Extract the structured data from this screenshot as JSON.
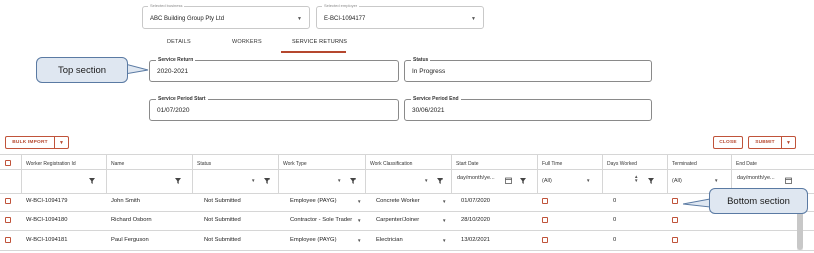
{
  "top_selects": {
    "business": {
      "label": "Selected business",
      "value": "ABC Building Group Pty Ltd"
    },
    "employer": {
      "label": "Selected employer",
      "value": "E-BCI-1094177"
    }
  },
  "tabs": [
    {
      "label": "DETAILS"
    },
    {
      "label": "WORKERS"
    },
    {
      "label": "SERVICE RETURNS",
      "active": true
    }
  ],
  "service_fields": {
    "return": {
      "label": "Service Return",
      "value": "2020-2021"
    },
    "status": {
      "label": "Status",
      "value": "In Progress"
    },
    "period_start": {
      "label": "Service Period Start",
      "value": "01/07/2020"
    },
    "period_end": {
      "label": "Service Period End",
      "value": "30/06/2021"
    }
  },
  "callouts": {
    "top": "Top section",
    "bottom": "Bottom section"
  },
  "toolbar": {
    "bulk_import": "BULK IMPORT",
    "close": "CLOSE",
    "submit": "SUBMIT"
  },
  "table": {
    "columns": [
      "Worker Registration Id",
      "Name",
      "Status",
      "Work Type",
      "Work Classification",
      "Start Date",
      "Full Time",
      "Days Worked",
      "Terminated",
      "End Date"
    ],
    "filters": {
      "start_date": "day/month/ye...",
      "full_time": "(All)",
      "terminated": "(All)",
      "end_date": "day/month/ye..."
    },
    "rows": [
      {
        "id": "W-BCI-1094179",
        "name": "John Smith",
        "status": "Not Submitted",
        "work_type": "Employee (PAYG)",
        "classification": "Concrete Worker",
        "start_date": "01/07/2020",
        "days_worked": "0"
      },
      {
        "id": "W-BCI-1094180",
        "name": "Richard Osborn",
        "status": "Not Submitted",
        "work_type": "Contractor - Sole Trader",
        "classification": "Carpenter/Joiner",
        "start_date": "28/10/2020",
        "days_worked": "0"
      },
      {
        "id": "W-BCI-1094181",
        "name": "Paul Ferguson",
        "status": "Not Submitted",
        "work_type": "Employee (PAYG)",
        "classification": "Electrician",
        "start_date": "13/02/2021",
        "days_worked": "0"
      }
    ]
  },
  "colors": {
    "accent": "#b5472e",
    "callout_bg": "#dfe7f1",
    "callout_border": "#5a7aa3"
  },
  "icons": {
    "filter": "funnel-icon",
    "filter_clear": "funnel-clear-icon",
    "calendar": "calendar-icon",
    "dropdown": "chevron-down-icon"
  }
}
